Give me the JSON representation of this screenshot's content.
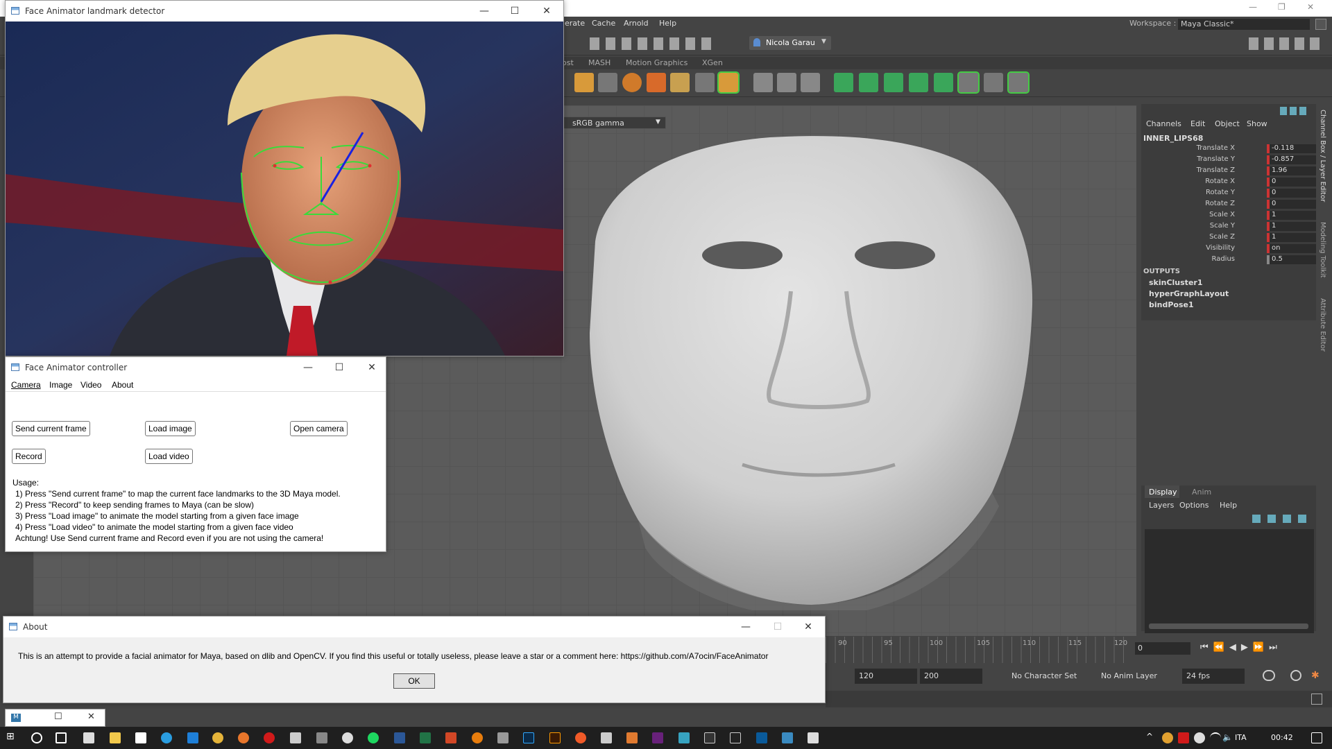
{
  "maya": {
    "menus": [
      "erate",
      "Cache",
      "Arnold",
      "Help"
    ],
    "workspace_label": "Workspace :",
    "workspace_value": "Maya Classic*",
    "user_name": "Nicola Garau",
    "shelf_tabs": [
      "ost",
      "MASH",
      "Motion Graphics",
      "XGen"
    ],
    "color_management": "sRGB gamma",
    "channel_box": {
      "menus": [
        "Channels",
        "Edit",
        "Object",
        "Show"
      ],
      "node_name": "INNER_LIPS68",
      "attributes": [
        {
          "label": "Translate X",
          "value": "-0.118"
        },
        {
          "label": "Translate Y",
          "value": "-0.857"
        },
        {
          "label": "Translate Z",
          "value": "1.96"
        },
        {
          "label": "Rotate X",
          "value": "0"
        },
        {
          "label": "Rotate Y",
          "value": "0"
        },
        {
          "label": "Rotate Z",
          "value": "0"
        },
        {
          "label": "Scale X",
          "value": "1"
        },
        {
          "label": "Scale Y",
          "value": "1"
        },
        {
          "label": "Scale Z",
          "value": "1"
        },
        {
          "label": "Visibility",
          "value": "on"
        },
        {
          "label": "Radius",
          "value": "0.5"
        }
      ],
      "outputs_label": "OUTPUTS",
      "outputs": [
        "skinCluster1",
        "hyperGraphLayout",
        "bindPose1"
      ]
    },
    "side_tabs": [
      "Channel Box / Layer Editor",
      "Modeling Toolkit",
      "Attribute Editor"
    ],
    "layer_editor": {
      "tabs": [
        "Display",
        "Anim"
      ],
      "menus": [
        "Layers",
        "Options",
        "Help"
      ]
    },
    "timeline_ticks": [
      "90",
      "95",
      "100",
      "105",
      "110",
      "115",
      "120"
    ],
    "current_frame": "0",
    "range": {
      "end": "120",
      "anim_end": "200"
    },
    "character_set": "No Character Set",
    "anim_layer": "No Anim Layer",
    "fps": "24 fps"
  },
  "landmark_window": {
    "title": "Face Animator landmark detector"
  },
  "controller": {
    "title": "Face Animator controller",
    "menus": [
      "Camera",
      "Image",
      "Video",
      "About"
    ],
    "buttons": {
      "send": "Send current frame",
      "load_image": "Load image",
      "open_camera": "Open camera",
      "record": "Record",
      "load_video": "Load video"
    },
    "usage": [
      "Usage:",
      "1) Press \"Send current frame\" to map the current face landmarks to the 3D Maya model.",
      "2) Press \"Record\" to keep sending frames to Maya (can be slow)",
      "3) Press \"Load image\" to animate the model starting from a given face image",
      "4) Press \"Load video\" to animate the model starting from a given face video",
      "Achtung! Use Send current frame and Record even if you are not using the camera!"
    ]
  },
  "about": {
    "title": "About",
    "message": "This is an attempt to provide a facial animator for Maya, based on dlib and OpenCV. If you find this useful or totally useless, please leave a star or a comment here: https://github.com/A7ocin/FaceAnimator",
    "ok": "OK"
  },
  "taskbar": {
    "language": "ITA",
    "time": "00:42"
  },
  "colors": {
    "landmark_green": "#3adb3a",
    "head_pose_blue": "#1a22e0",
    "maya_bg": "#444444"
  }
}
